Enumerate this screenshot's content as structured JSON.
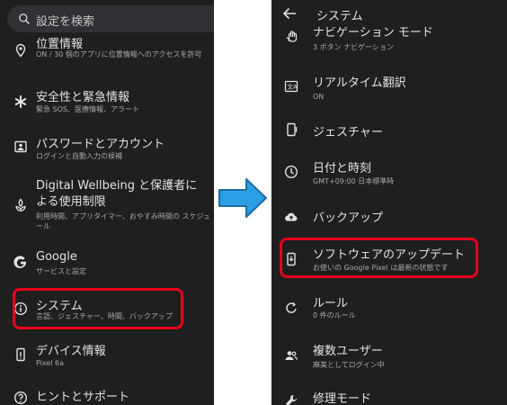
{
  "left": {
    "search_placeholder": "設定を検索",
    "location": {
      "title": "位置情報",
      "sub": "ON / 30 個のアプリに位置情報へのアクセスを許可"
    },
    "safety": {
      "title": "安全性と緊急情報",
      "sub": "緊急 SOS、医療情報、アラート"
    },
    "password": {
      "title": "パスワードとアカウント",
      "sub": "ログインと自動入力の候補"
    },
    "wellbeing": {
      "title": "Digital Wellbeing と保護者による使用制限",
      "sub": "利用時間、アプリタイマー、おやすみ時間の スケジュール"
    },
    "google": {
      "title": "Google",
      "sub": "サービスと設定"
    },
    "system": {
      "title": "システム",
      "sub": "言語、ジェスチャー、時間、バックアップ"
    },
    "device": {
      "title": "デバイス情報",
      "sub": "Pixel 6a"
    },
    "tips": {
      "title": "ヒントとサポート"
    }
  },
  "right": {
    "title": "システム",
    "navmode": {
      "title": "ナビゲーション モード",
      "sub": "3 ボタン ナビゲーション"
    },
    "translate": {
      "title": "リアルタイム翻訳",
      "sub": "ON"
    },
    "gesture": {
      "title": "ジェスチャー"
    },
    "datetime": {
      "title": "日付と時刻",
      "sub": "GMT+09:00 日本標準時"
    },
    "backup": {
      "title": "バックアップ"
    },
    "update": {
      "title": "ソフトウェアのアップデート",
      "sub": "お使いの Google Pixel は最新の状態です"
    },
    "rules": {
      "title": "ルール",
      "sub": "0 件のルール"
    },
    "multiuser": {
      "title": "複数ユーザー",
      "sub": "麻美としてログイン中"
    },
    "repair": {
      "title": "修理モード"
    }
  },
  "colors": {
    "panel_bg": "#1f1f1f",
    "highlight": "#e8001c",
    "arrow": "#2b9ee6"
  },
  "icons": [
    "search-icon",
    "location-pin-icon",
    "asterisk-icon",
    "password-icon",
    "wellbeing-icon",
    "google-g-icon",
    "info-icon",
    "device-icon",
    "help-icon",
    "back-arrow-icon",
    "gesture-hand-icon",
    "translate-icon",
    "phone-gesture-icon",
    "clock-icon",
    "cloud-upload-icon",
    "system-update-icon",
    "rules-icon",
    "people-icon",
    "wrench-icon",
    "right-arrow-icon"
  ]
}
